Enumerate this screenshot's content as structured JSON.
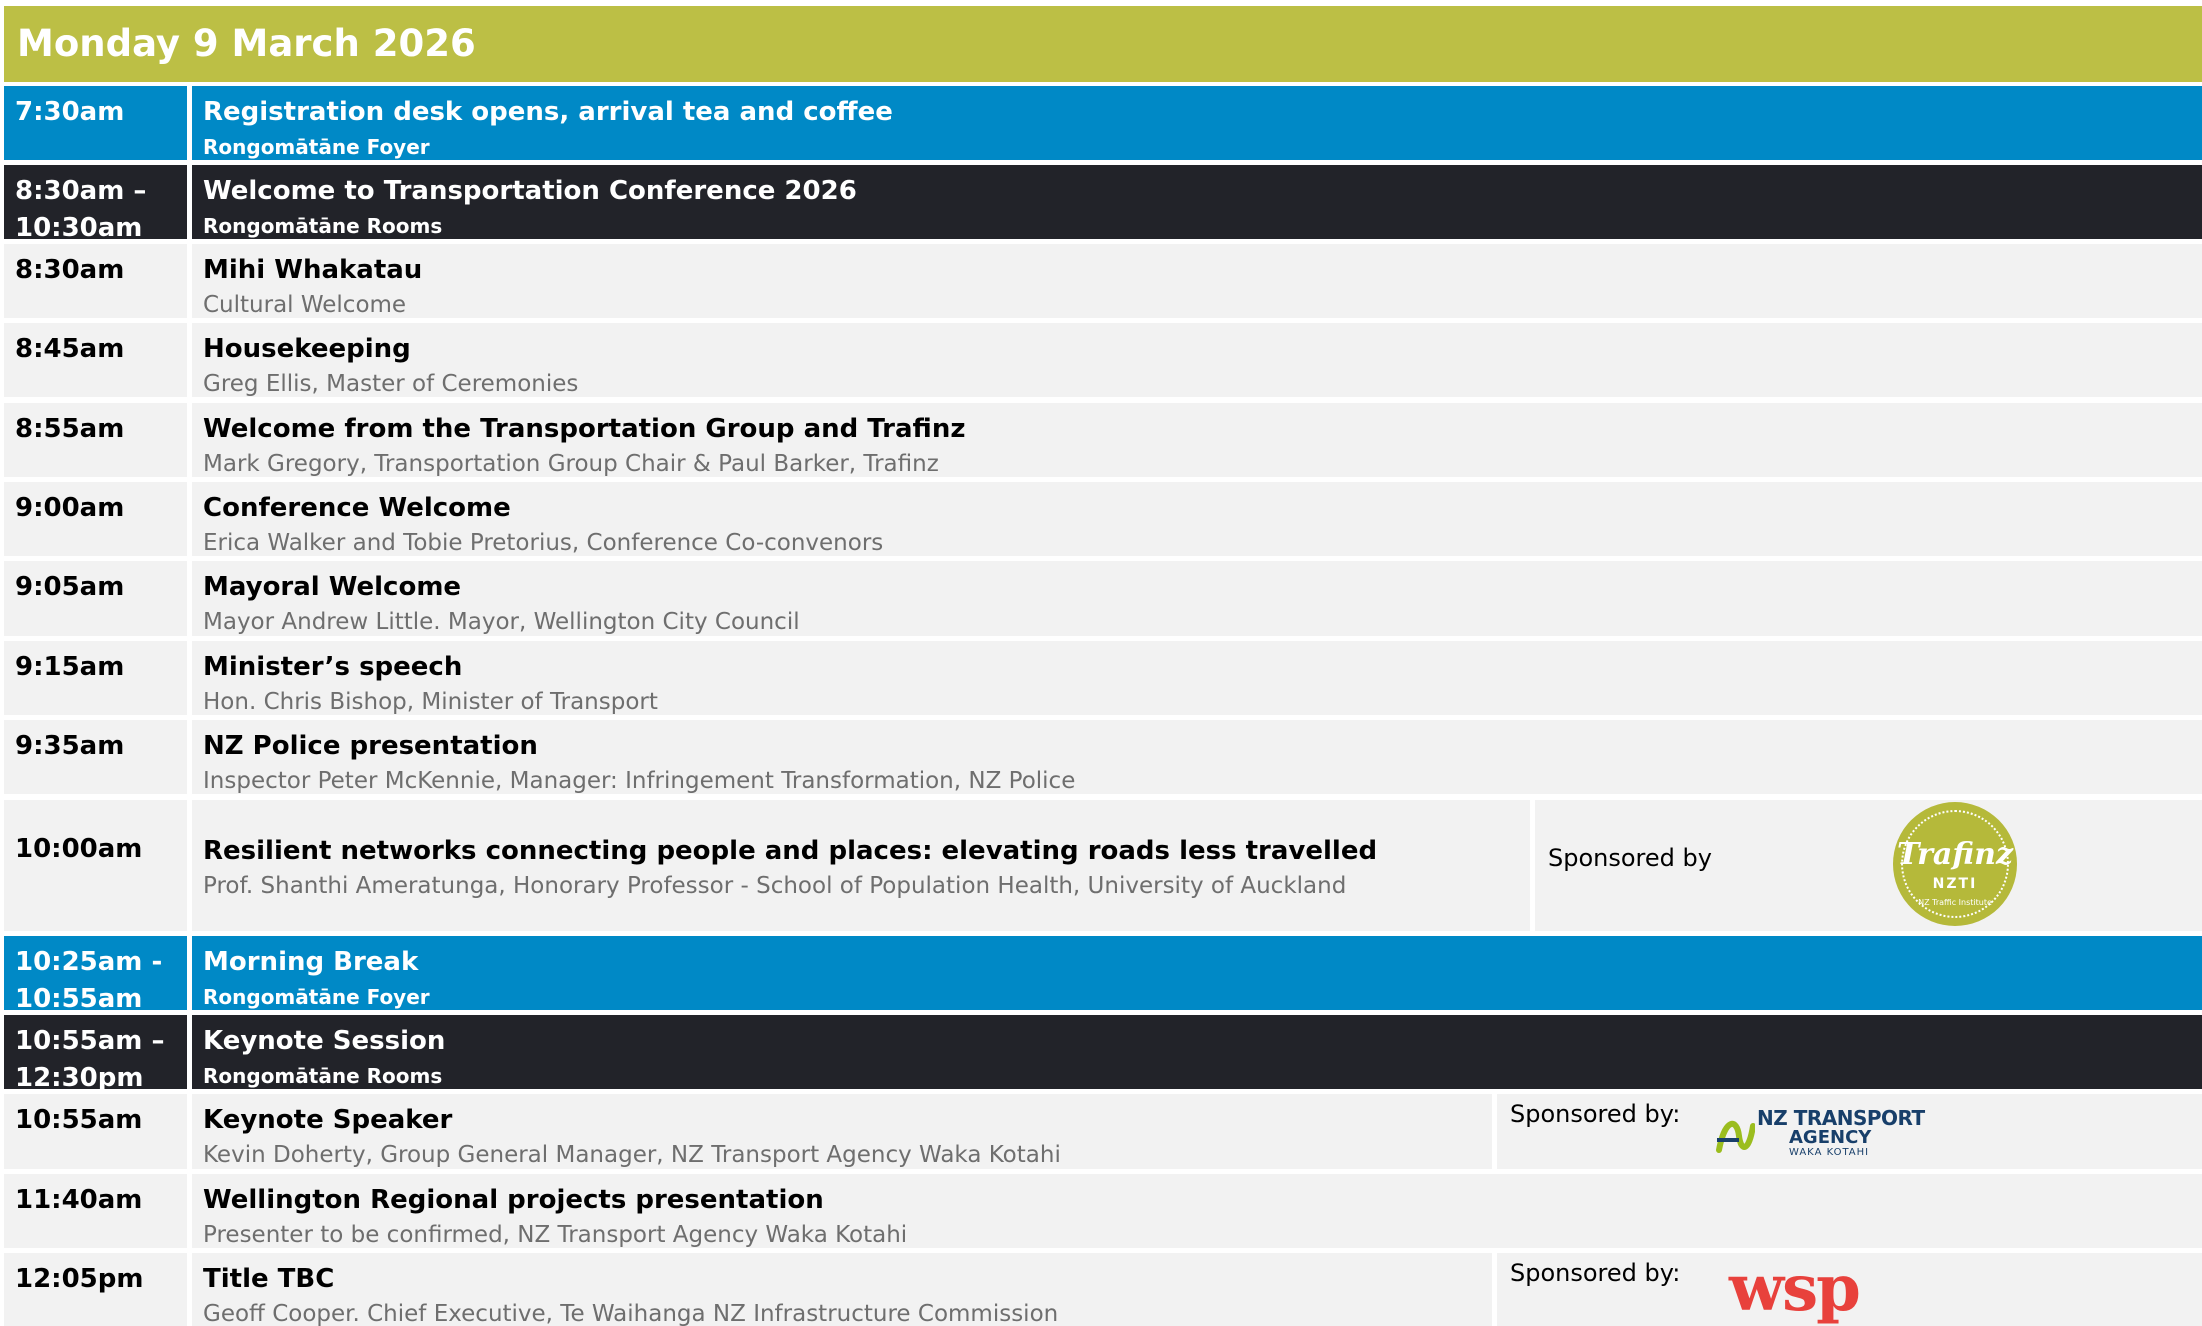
{
  "day_title": "Monday 9 March 2026",
  "sessions": [
    {
      "time": "7:30am",
      "title": "Registration desk opens, arrival tea and coffee",
      "location": "Rongomātāne Foyer"
    },
    {
      "time": "8:30am –\n10:30am",
      "title": "Welcome to Transportation Conference 2026",
      "location": "Rongomātāne Rooms"
    },
    {
      "time": "8:30am",
      "title": "Mihi Whakatau",
      "subtitle": "Cultural Welcome"
    },
    {
      "time": "8:45am",
      "title": "Housekeeping",
      "subtitle": "Greg Ellis, Master of Ceremonies"
    },
    {
      "time": "8:55am",
      "title": "Welcome from the Transportation Group and Trafinz",
      "subtitle": "Mark Gregory, Transportation Group Chair & Paul Barker, Trafinz"
    },
    {
      "time": "9:00am",
      "title": "Conference Welcome",
      "subtitle": "Erica Walker and Tobie Pretorius, Conference Co-convenors"
    },
    {
      "time": "9:05am",
      "title": "Mayoral Welcome",
      "subtitle": "Mayor Andrew Little. Mayor, Wellington City Council"
    },
    {
      "time": "9:15am",
      "title": "Minister’s speech",
      "subtitle": "Hon. Chris Bishop, Minister of Transport"
    },
    {
      "time": "9:35am",
      "title": "NZ Police presentation",
      "subtitle": "Inspector Peter McKennie, Manager: Infringement Transformation, NZ Police"
    },
    {
      "time": "10:00am",
      "title": "Resilient networks connecting people and places: elevating roads less travelled",
      "subtitle": "Prof. Shanthi Ameratunga, Honorary Professor - School of Population Health, University of Auckland",
      "sponsor_label": "Sponsored by"
    },
    {
      "time": "10:25am -\n10:55am",
      "title": "Morning Break",
      "location": "Rongomātāne Foyer"
    },
    {
      "time": "10:55am –\n12:30pm",
      "title": "Keynote Session",
      "location": "Rongomātāne Rooms"
    },
    {
      "time": "10:55am",
      "title": "Keynote Speaker",
      "subtitle": "Kevin Doherty, Group General Manager, NZ Transport Agency Waka Kotahi",
      "sponsor_label": "Sponsored by:"
    },
    {
      "time": "11:40am",
      "title": "Wellington Regional projects presentation",
      "subtitle": "Presenter to be confirmed, NZ Transport Agency Waka Kotahi"
    },
    {
      "time": "12:05pm",
      "title": "Title TBC",
      "subtitle": "Geoff Cooper. Chief Executive, Te Waihanga NZ Infrastructure Commission",
      "sponsor_label": "Sponsored by:"
    }
  ],
  "logos": {
    "trafinz": {
      "word": "Trafinz",
      "mark": "NZTI",
      "tagline": "NZ Traffic Institute",
      "color": "#b5b93a"
    },
    "nzta": {
      "line1": "NZ TRANSPORT",
      "line2": "AGENCY",
      "line3": "WAKA KOTAHI",
      "color": "#183f6a"
    },
    "wsp": {
      "word": "wsp",
      "color": "#e8413c"
    }
  },
  "colors": {
    "header": "#bcbf45",
    "blue": "#0089c6",
    "dark": "#222329",
    "light": "#f2f2f2"
  }
}
